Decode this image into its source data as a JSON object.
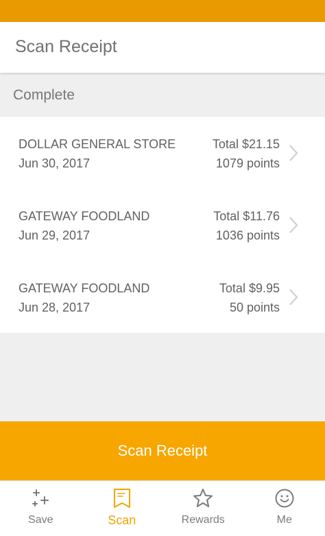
{
  "app_bar": {
    "title": "Scan Receipt"
  },
  "section": {
    "label": "Complete"
  },
  "receipts": [
    {
      "store": "DOLLAR GENERAL STORE",
      "date": "Jun 30, 2017",
      "total": "Total $21.15",
      "points": "1079 points"
    },
    {
      "store": "GATEWAY FOODLAND",
      "date": "Jun 29, 2017",
      "total": "Total $11.76",
      "points": "1036 points"
    },
    {
      "store": "GATEWAY FOODLAND",
      "date": "Jun 28, 2017",
      "total": "Total $9.95",
      "points": "50 points"
    }
  ],
  "cta": {
    "label": "Scan Receipt"
  },
  "bottom_nav": {
    "items": [
      {
        "label": "Save",
        "icon": "sparkle-plus-icon"
      },
      {
        "label": "Scan",
        "icon": "receipt-icon",
        "active": true
      },
      {
        "label": "Rewards",
        "icon": "star-icon"
      },
      {
        "label": "Me",
        "icon": "smiley-icon"
      }
    ]
  },
  "colors": {
    "status_bar": "#e89a00",
    "accent": "#f7a600",
    "active_nav": "#f0a500",
    "text": "#616161"
  }
}
